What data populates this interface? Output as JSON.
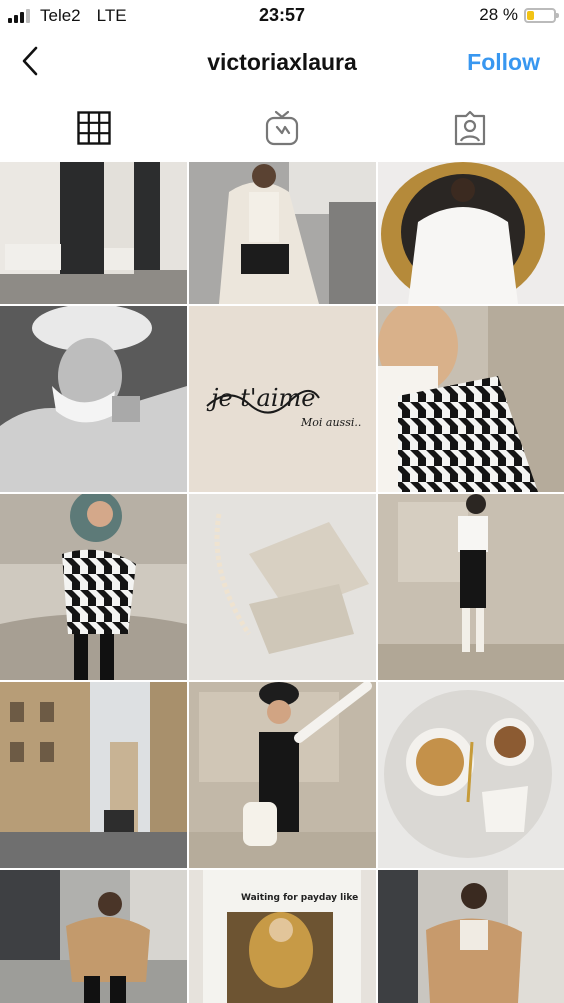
{
  "status_bar": {
    "carrier": "Tele2",
    "network": "LTE",
    "time": "23:57",
    "battery_percent": "28 %",
    "battery_level": 0.28,
    "battery_color": "#f2c314"
  },
  "nav": {
    "back_icon": "chevron-left-icon",
    "username": "victoriaxlaura",
    "follow_label": "Follow",
    "follow_color": "#3897f0"
  },
  "tabs": [
    {
      "icon": "grid-icon",
      "active": true
    },
    {
      "icon": "igtv-icon",
      "active": false
    },
    {
      "icon": "tagged-icon",
      "active": false
    }
  ],
  "posts": [
    {
      "description": "white building columns and dark doors"
    },
    {
      "description": "woman in white coat in street"
    },
    {
      "description": "woman in gold ornate mirror"
    },
    {
      "description": "woman drinking from white cup, black and white"
    },
    {
      "description": "handwritten note on beige card"
    },
    {
      "description": "houndstooth jacket closeup"
    },
    {
      "description": "woman in houndstooth jacket sitting by wall"
    },
    {
      "description": "pearl necklace with Gucci envelopes"
    },
    {
      "description": "woman in white shirt and black pinafore by plaque"
    },
    {
      "description": "Paris street with buildings"
    },
    {
      "description": "woman in black beret holding pearl bag"
    },
    {
      "description": "coffee tray with cups and milk jug"
    },
    {
      "description": "woman in fur coat on steps"
    },
    {
      "description": "t-shirt with painting print"
    },
    {
      "description": "woman in fur coat by building"
    }
  ],
  "captions": {
    "note_line1": "je t'aime",
    "note_line2": "Moi aussi..",
    "tshirt_text": "Waiting for payday like"
  }
}
